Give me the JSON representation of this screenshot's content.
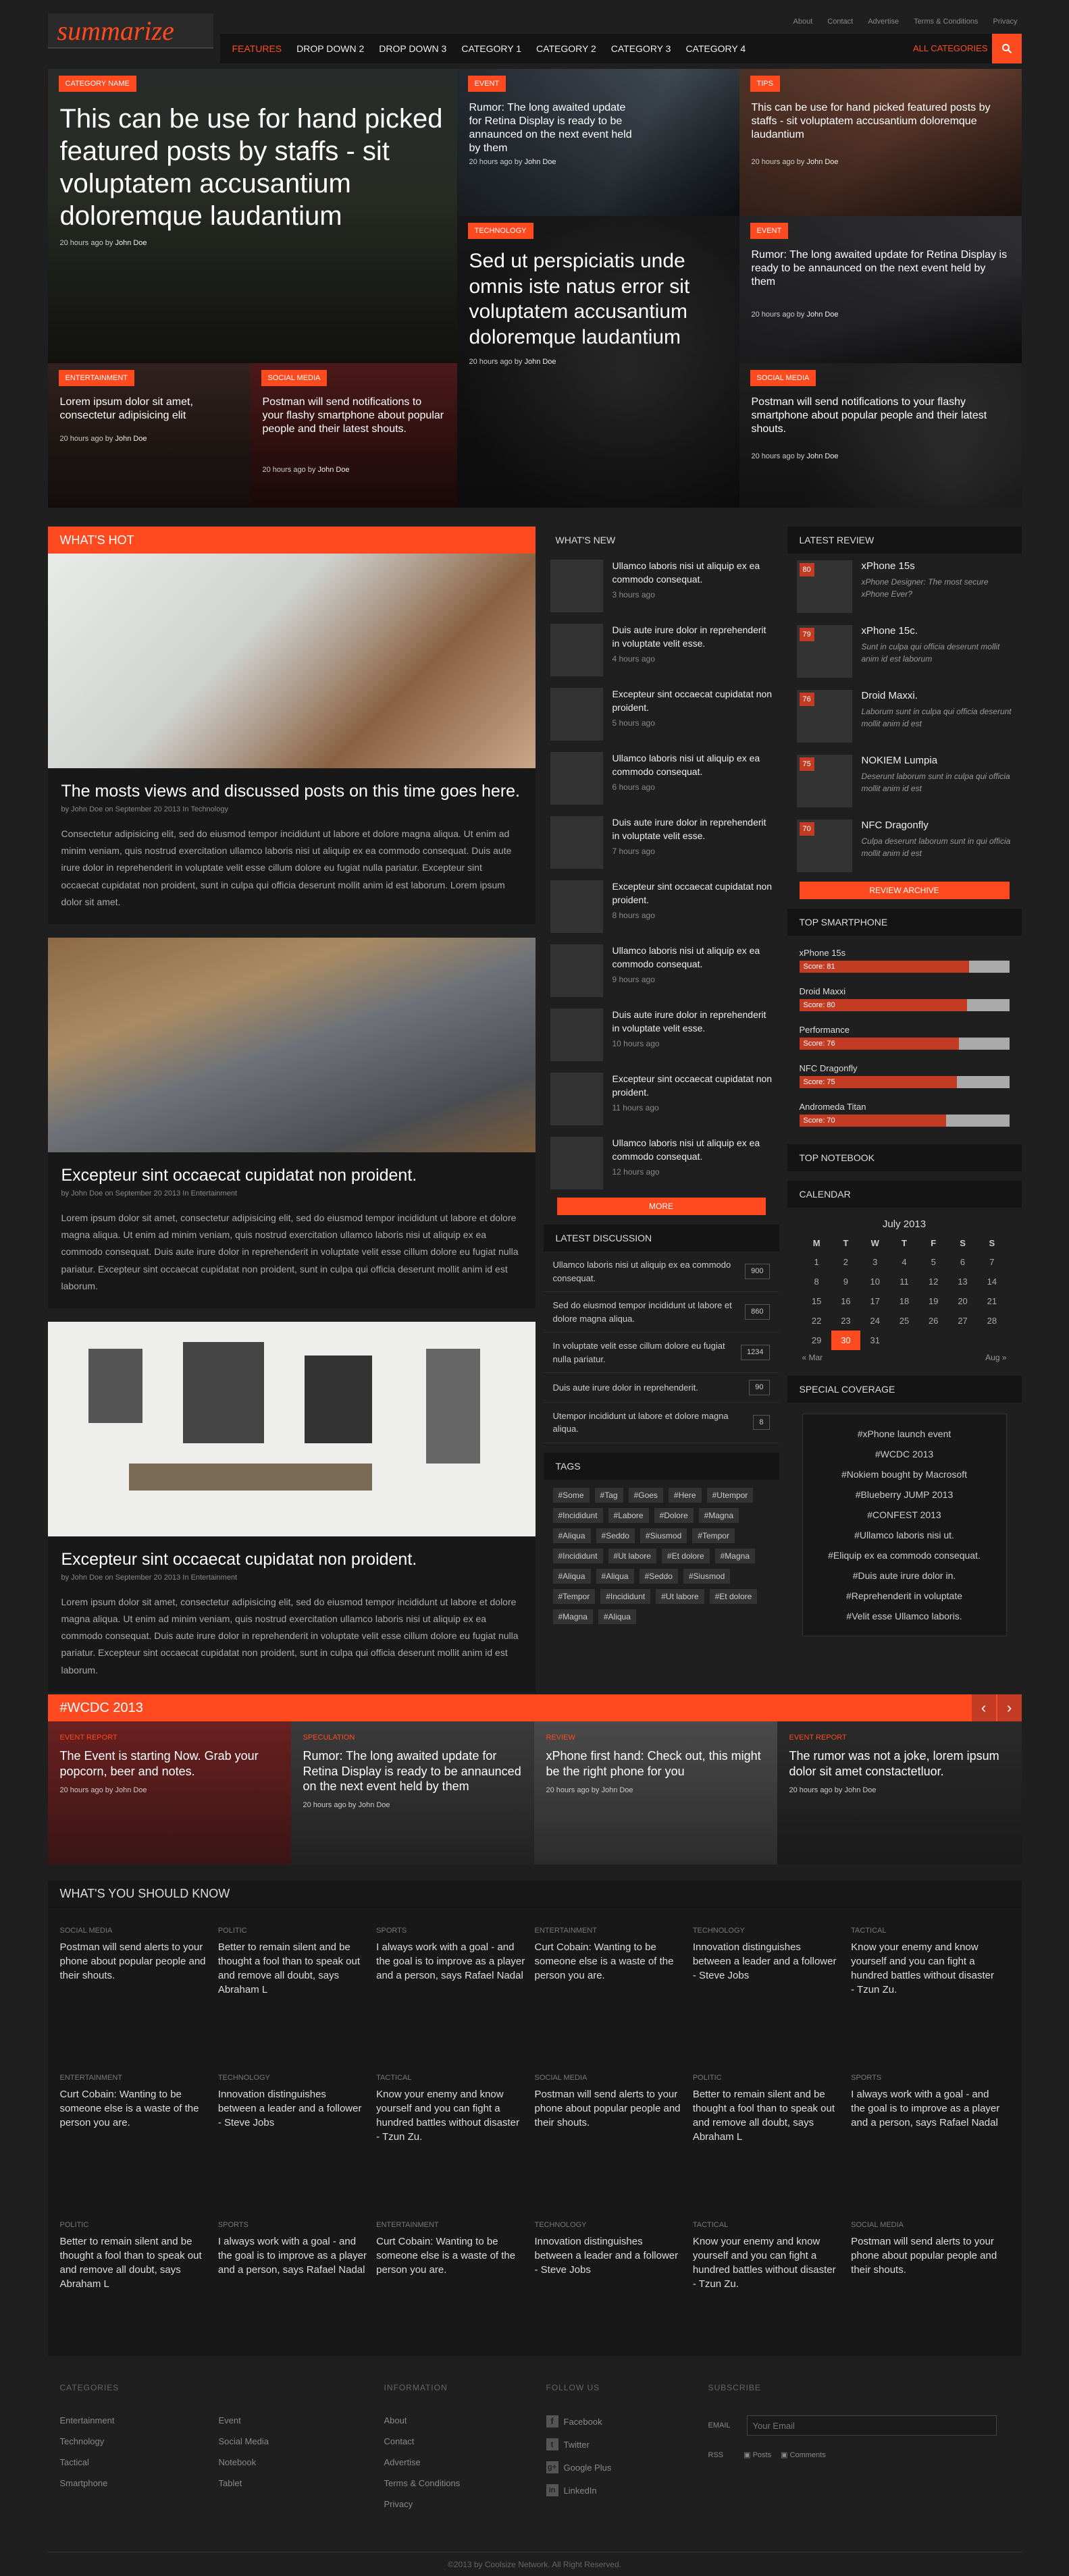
{
  "header": {
    "logo": "summarize",
    "top_links": [
      "About",
      "Contact",
      "Advertise",
      "Terms & Conditions",
      "Privacy"
    ],
    "nav": [
      "FEATURES",
      "DROP DOWN 2",
      "DROP DOWN 3",
      "CATEGORY 1",
      "CATEGORY 2",
      "CATEGORY 3",
      "CATEGORY 4"
    ],
    "all_categories": "ALL CATEGORIES"
  },
  "hero": {
    "big": {
      "cat": "CATEGORY NAME",
      "title": "This can be use for hand picked featured posts by staffs - sit voluptatem accusantium doloremque laudantium",
      "meta": "20 hours ago by",
      "author": "John Doe"
    },
    "t2": {
      "cat": "EVENT",
      "title": "Rumor: The long awaited update for Retina Display is ready to be annaunced on the next event held by them",
      "meta": "20 hours ago by",
      "author": "John Doe"
    },
    "t3": {
      "cat": "TIPS",
      "title": "This can be use for hand picked featured posts by staffs - sit voluptatem accusantium doloremque laudantium",
      "meta": "20 hours ago by",
      "author": "John Doe"
    },
    "t4": {
      "cat": "TECHNOLOGY",
      "title": "Sed ut perspiciatis unde omnis iste natus error sit voluptatem accusantium doloremque laudantium",
      "meta": "20 hours ago by",
      "author": "John Doe"
    },
    "t5": {
      "cat": "EVENT",
      "title": "Rumor: The long awaited update for Retina Display is ready to be annaunced on the next event held by them",
      "meta": "20 hours ago by",
      "author": "John Doe"
    },
    "t6": {
      "cat": "ENTERTAINMENT",
      "title": "Lorem ipsum dolor sit amet, consectetur adipisicing elit",
      "meta": "20 hours ago by",
      "author": "John Doe"
    },
    "t7": {
      "cat": "SOCIAL MEDIA",
      "title": "Postman will send notifications to your flashy smartphone about popular people and their latest shouts.",
      "meta": "20 hours ago by",
      "author": "John Doe"
    },
    "t8": {
      "cat": "SOCIAL MEDIA",
      "title": "Postman will send notifications to your flashy smartphone about popular people and their latest shouts.",
      "meta": "20 hours ago by",
      "author": "John Doe"
    }
  },
  "hot": {
    "label": "WHAT'S HOT",
    "posts": [
      {
        "title": "The mosts views and discussed posts on this time goes here.",
        "meta": "by John Doe on September 20 2013 In Technology",
        "body": "Consectetur adipisicing elit, sed do eiusmod tempor incididunt ut labore et dolore magna aliqua. Ut enim ad minim veniam, quis nostrud exercitation ullamco laboris nisi ut aliquip ex ea commodo consequat. Duis aute irure dolor in reprehenderit in voluptate velit esse cillum dolore eu fugiat nulla pariatur. Excepteur sint occaecat cupidatat non proident, sunt in culpa qui officia deserunt mollit anim id est laborum. Lorem ipsum dolor sit amet."
      },
      {
        "title": "Excepteur sint occaecat cupidatat non proident.",
        "meta": "by John Doe on September 20 2013 In Entertainment",
        "body": "Lorem ipsum dolor sit amet, consectetur adipisicing elit, sed do eiusmod tempor incididunt ut labore et dolore magna aliqua. Ut enim ad minim veniam, quis nostrud exercitation ullamco laboris nisi ut aliquip ex ea commodo consequat. Duis aute irure dolor in reprehenderit in voluptate velit esse cillum dolore eu fugiat nulla pariatur. Excepteur sint occaecat cupidatat non proident, sunt in culpa qui officia deserunt mollit anim id est laborum."
      },
      {
        "title": "Excepteur sint occaecat cupidatat non proident.",
        "meta": "by John Doe on September 20 2013 In Entertainment",
        "body": "Lorem ipsum dolor sit amet, consectetur adipisicing elit, sed do eiusmod tempor incididunt ut labore et dolore magna aliqua. Ut enim ad minim veniam, quis nostrud exercitation ullamco laboris nisi ut aliquip ex ea commodo consequat. Duis aute irure dolor in reprehenderit in voluptate velit esse cillum dolore eu fugiat nulla pariatur. Excepteur sint occaecat cupidatat non proident, sunt in culpa qui officia deserunt mollit anim id est laborum."
      }
    ]
  },
  "whats_new": {
    "label": "WHAT'S NEW",
    "more": "MORE",
    "items": [
      {
        "title": "Ullamco laboris nisi ut aliquip ex ea commodo consequat.",
        "time": "3 hours ago"
      },
      {
        "title": "Duis aute irure dolor in reprehenderit in voluptate velit esse.",
        "time": "4 hours ago"
      },
      {
        "title": "Excepteur sint occaecat cupidatat non proident.",
        "time": "5 hours ago"
      },
      {
        "title": "Ullamco laboris nisi ut aliquip ex ea commodo consequat.",
        "time": "6 hours ago"
      },
      {
        "title": "Duis aute irure dolor in reprehenderit in voluptate velit esse.",
        "time": "7 hours ago"
      },
      {
        "title": "Excepteur sint occaecat cupidatat non proident.",
        "time": "8 hours ago"
      },
      {
        "title": "Ullamco laboris nisi ut aliquip ex ea commodo consequat.",
        "time": "9 hours ago"
      },
      {
        "title": "Duis aute irure dolor in reprehenderit in voluptate velit esse.",
        "time": "10 hours ago"
      },
      {
        "title": "Excepteur sint occaecat cupidatat non proident.",
        "time": "11 hours ago"
      },
      {
        "title": "Ullamco laboris nisi ut aliquip ex ea commodo consequat.",
        "time": "12 hours ago"
      }
    ]
  },
  "discussion": {
    "label": "LATEST DISCUSSION",
    "items": [
      {
        "text": "Ullamco laboris nisi ut aliquip ex ea commodo consequat.",
        "count": "900"
      },
      {
        "text": "Sed do eiusmod tempor incididunt ut labore et dolore magna aliqua.",
        "count": "860"
      },
      {
        "text": "In voluptate velit esse cillum dolore eu fugiat nulla pariatur.",
        "count": "1234"
      },
      {
        "text": "Duis aute irure dolor in reprehenderit.",
        "count": "90"
      },
      {
        "text": "Utempor incididunt ut labore et dolore magna aliqua.",
        "count": "8"
      }
    ]
  },
  "tags": {
    "label": "TAGS",
    "items": [
      "#Some",
      "#Tag",
      "#Goes",
      "#Here",
      "#Utempor",
      "#Incididunt",
      "#Labore",
      "#Dolore",
      "#Magna",
      "#Aliqua",
      "#Seddo",
      "#Siusmod",
      "#Tempor",
      "#Incididunt",
      "#Ut labore",
      "#Et dolore",
      "#Magna",
      "#Aliqua",
      "#Aliqua",
      "#Seddo",
      "#Siusmod",
      "#Tempor",
      "#Incididunt",
      "#Ut labore",
      "#Et dolore",
      "#Magna",
      "#Aliqua"
    ]
  },
  "review": {
    "label": "LATEST REVIEW",
    "archive": "REVIEW ARCHIVE",
    "items": [
      {
        "score": "80",
        "title": "xPhone 15s",
        "desc": "xPhone Designer: The most secure xPhone Ever?"
      },
      {
        "score": "79",
        "title": "xPhone 15c.",
        "desc": "Sunt in culpa qui officia deserunt mollit anim id est laborum"
      },
      {
        "score": "76",
        "title": "Droid Maxxi.",
        "desc": "Laborum sunt in culpa qui officia deserunt mollit anim id est"
      },
      {
        "score": "75",
        "title": "NOKIEM Lumpia",
        "desc": "Deserunt laborum sunt in culpa qui officia mollit anim id est"
      },
      {
        "score": "70",
        "title": "NFC Dragonfly",
        "desc": "Culpa deserunt laborum sunt in qui officia mollit anim id est"
      }
    ]
  },
  "top_smartphone": {
    "label": "TOP SMARTPHONE",
    "items": [
      {
        "name": "xPhone 15s",
        "score_label": "Score: 81",
        "value": 81
      },
      {
        "name": "Droid Maxxi",
        "score_label": "Score: 80",
        "value": 80
      },
      {
        "name": "Performance",
        "score_label": "Score: 76",
        "value": 76
      },
      {
        "name": "NFC Dragonfly",
        "score_label": "Score: 75",
        "value": 75
      },
      {
        "name": "Andromeda Titan",
        "score_label": "Score: 70",
        "value": 70
      }
    ]
  },
  "notebook": {
    "label": "TOP NOTEBOOK"
  },
  "calendar": {
    "label": "CALENDAR",
    "month": "July 2013",
    "days": [
      "M",
      "T",
      "W",
      "T",
      "F",
      "S",
      "S"
    ],
    "weeks": [
      [
        "1",
        "2",
        "3",
        "4",
        "5",
        "6",
        "7"
      ],
      [
        "8",
        "9",
        "10",
        "11",
        "12",
        "13",
        "14"
      ],
      [
        "15",
        "16",
        "17",
        "18",
        "19",
        "20",
        "21"
      ],
      [
        "22",
        "23",
        "24",
        "25",
        "26",
        "27",
        "28"
      ],
      [
        "29",
        "30",
        "31",
        "",
        "",
        "",
        ""
      ]
    ],
    "today": "30",
    "prev": "« Mar",
    "next": "Aug »"
  },
  "coverage": {
    "label": "SPECIAL COVERAGE",
    "items": [
      "#xPhone launch event",
      "#WCDC 2013",
      "#Nokiem bought by Macrosoft",
      "#Blueberry JUMP 2013",
      "#CONFEST 2013",
      "#Ullamco laboris nisi ut.",
      "#Eliquip ex ea commodo consequat.",
      "#Duis aute irure dolor in.",
      "#Reprehenderit in voluptate",
      "#Velit esse Ullamco laboris."
    ]
  },
  "wcdc": {
    "label": "#WCDC 2013",
    "items": [
      {
        "cat": "EVENT REPORT",
        "title": "The Event is starting Now. Grab your popcorn, beer and notes.",
        "meta": "20 hours ago by",
        "author": "John Doe"
      },
      {
        "cat": "SPECULATION",
        "title": "Rumor: The long awaited update for Retina Display is ready to be annaunced on the next event held by them",
        "meta": "20 hours ago by",
        "author": "John Doe"
      },
      {
        "cat": "REVIEW",
        "title": "xPhone first hand: Check out, this might be the right phone for you",
        "meta": "20 hours ago by",
        "author": "John Doe"
      },
      {
        "cat": "EVENT REPORT",
        "title": "The rumor was not a joke, lorem ipsum dolor sit amet constactetluor.",
        "meta": "20 hours ago by",
        "author": "John Doe"
      }
    ]
  },
  "know": {
    "label": "WHAT'S YOU SHOULD KNOW",
    "items": [
      {
        "cat": "SOCIAL MEDIA",
        "text": "Postman will send alerts to your phone about popular people and their shouts."
      },
      {
        "cat": "POLITIC",
        "text": "Better to remain silent and be thought a fool than to speak out and remove all doubt, says Abraham L"
      },
      {
        "cat": "SPORTS",
        "text": "I always work with a goal - and the goal is to improve as a player and a person, says Rafael Nadal"
      },
      {
        "cat": "ENTERTAINMENT",
        "text": "Curt Cobain: Wanting to be someone else is a waste of the person you are."
      },
      {
        "cat": "TECHNOLOGY",
        "text": "Innovation distinguishes between a leader and a follower - Steve Jobs"
      },
      {
        "cat": "TACTICAL",
        "text": "Know your enemy and know yourself and you can fight a hundred battles without disaster - Tzun Zu."
      },
      {
        "cat": "ENTERTAINMENT",
        "text": "Curt Cobain: Wanting to be someone else is a waste of the person you are."
      },
      {
        "cat": "TECHNOLOGY",
        "text": "Innovation distinguishes between a leader and a follower - Steve Jobs"
      },
      {
        "cat": "TACTICAL",
        "text": "Know your enemy and know yourself and you can fight a hundred battles without disaster - Tzun Zu."
      },
      {
        "cat": "SOCIAL MEDIA",
        "text": "Postman will send alerts to your phone about popular people and their shouts."
      },
      {
        "cat": "POLITIC",
        "text": "Better to remain silent and be thought a fool than to speak out and remove all doubt, says Abraham L"
      },
      {
        "cat": "SPORTS",
        "text": "I always work with a goal - and the goal is to improve as a player and a person, says Rafael Nadal"
      },
      {
        "cat": "POLITIC",
        "text": "Better to remain silent and be thought a fool than to speak out and remove all doubt, says Abraham L"
      },
      {
        "cat": "SPORTS",
        "text": "I always work with a goal - and the goal is to improve as a player and a person, says Rafael Nadal"
      },
      {
        "cat": "ENTERTAINMENT",
        "text": "Curt Cobain: Wanting to be someone else is a waste of the person you are."
      },
      {
        "cat": "TECHNOLOGY",
        "text": "Innovation distinguishes between a leader and a follower - Steve Jobs"
      },
      {
        "cat": "TACTICAL",
        "text": "Know your enemy and know yourself and you can fight a hundred battles without disaster - Tzun Zu."
      },
      {
        "cat": "SOCIAL MEDIA",
        "text": "Postman will send alerts to your phone about popular people and their shouts."
      }
    ]
  },
  "footer": {
    "categories": {
      "label": "CATEGORIES",
      "items": [
        "Entertainment",
        "Event",
        "Technology",
        "Social Media",
        "Tactical",
        "Notebook",
        "Smartphone",
        "Tablet"
      ]
    },
    "information": {
      "label": "INFORMATION",
      "items": [
        "About",
        "Contact",
        "Advertise",
        "Terms & Conditions",
        "Privacy"
      ]
    },
    "follow": {
      "label": "FOLLOW US",
      "items": [
        "Facebook",
        "Twitter",
        "Google Plus",
        "LinkedIn"
      ]
    },
    "subscribe": {
      "label": "SUBSCRIBE",
      "email_label": "EMAIL",
      "email_placeholder": "Your Email",
      "rss_label": "RSS",
      "rss_posts": "Posts",
      "rss_comments": "Comments"
    },
    "copyright": "©2013 by Coolsize Network. All Right Reserved."
  },
  "colors": {
    "accent": "#ff4a1f",
    "accent_dark": "#c23b22",
    "bg": "#1f1f1f",
    "panel": "#141414"
  }
}
